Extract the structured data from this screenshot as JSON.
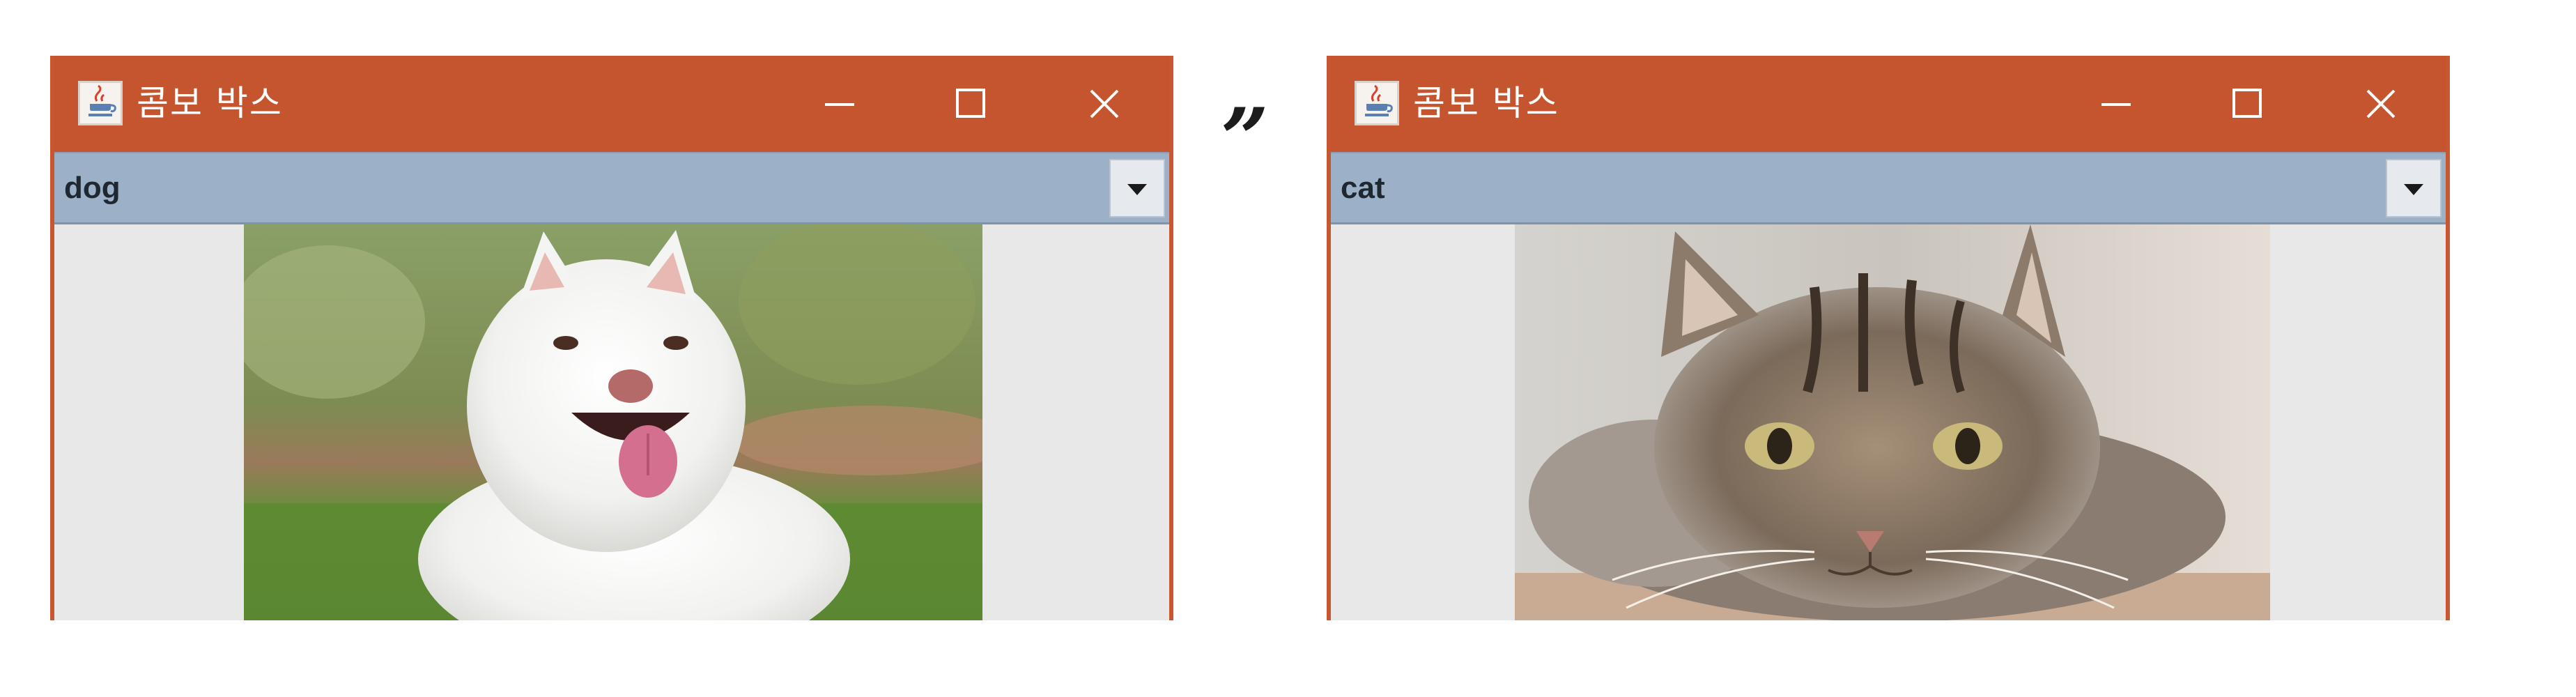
{
  "windows": [
    {
      "title": "콤보 박스",
      "combo": {
        "selected": "dog"
      },
      "image": {
        "subject": "white fluffy dog lying on grass"
      }
    },
    {
      "title": "콤보 박스",
      "combo": {
        "selected": "cat"
      },
      "image": {
        "subject": "tabby cat lying down"
      }
    }
  ],
  "separator": "”",
  "colors": {
    "titlebar": "#c5552f",
    "combo": "#9cb1c8",
    "content_bg": "#e9e8e8"
  },
  "icons": {
    "app": "java-coffee-icon",
    "minimize": "minimize-icon",
    "maximize": "maximize-icon",
    "close": "close-icon",
    "dropdown": "chevron-down-icon"
  }
}
